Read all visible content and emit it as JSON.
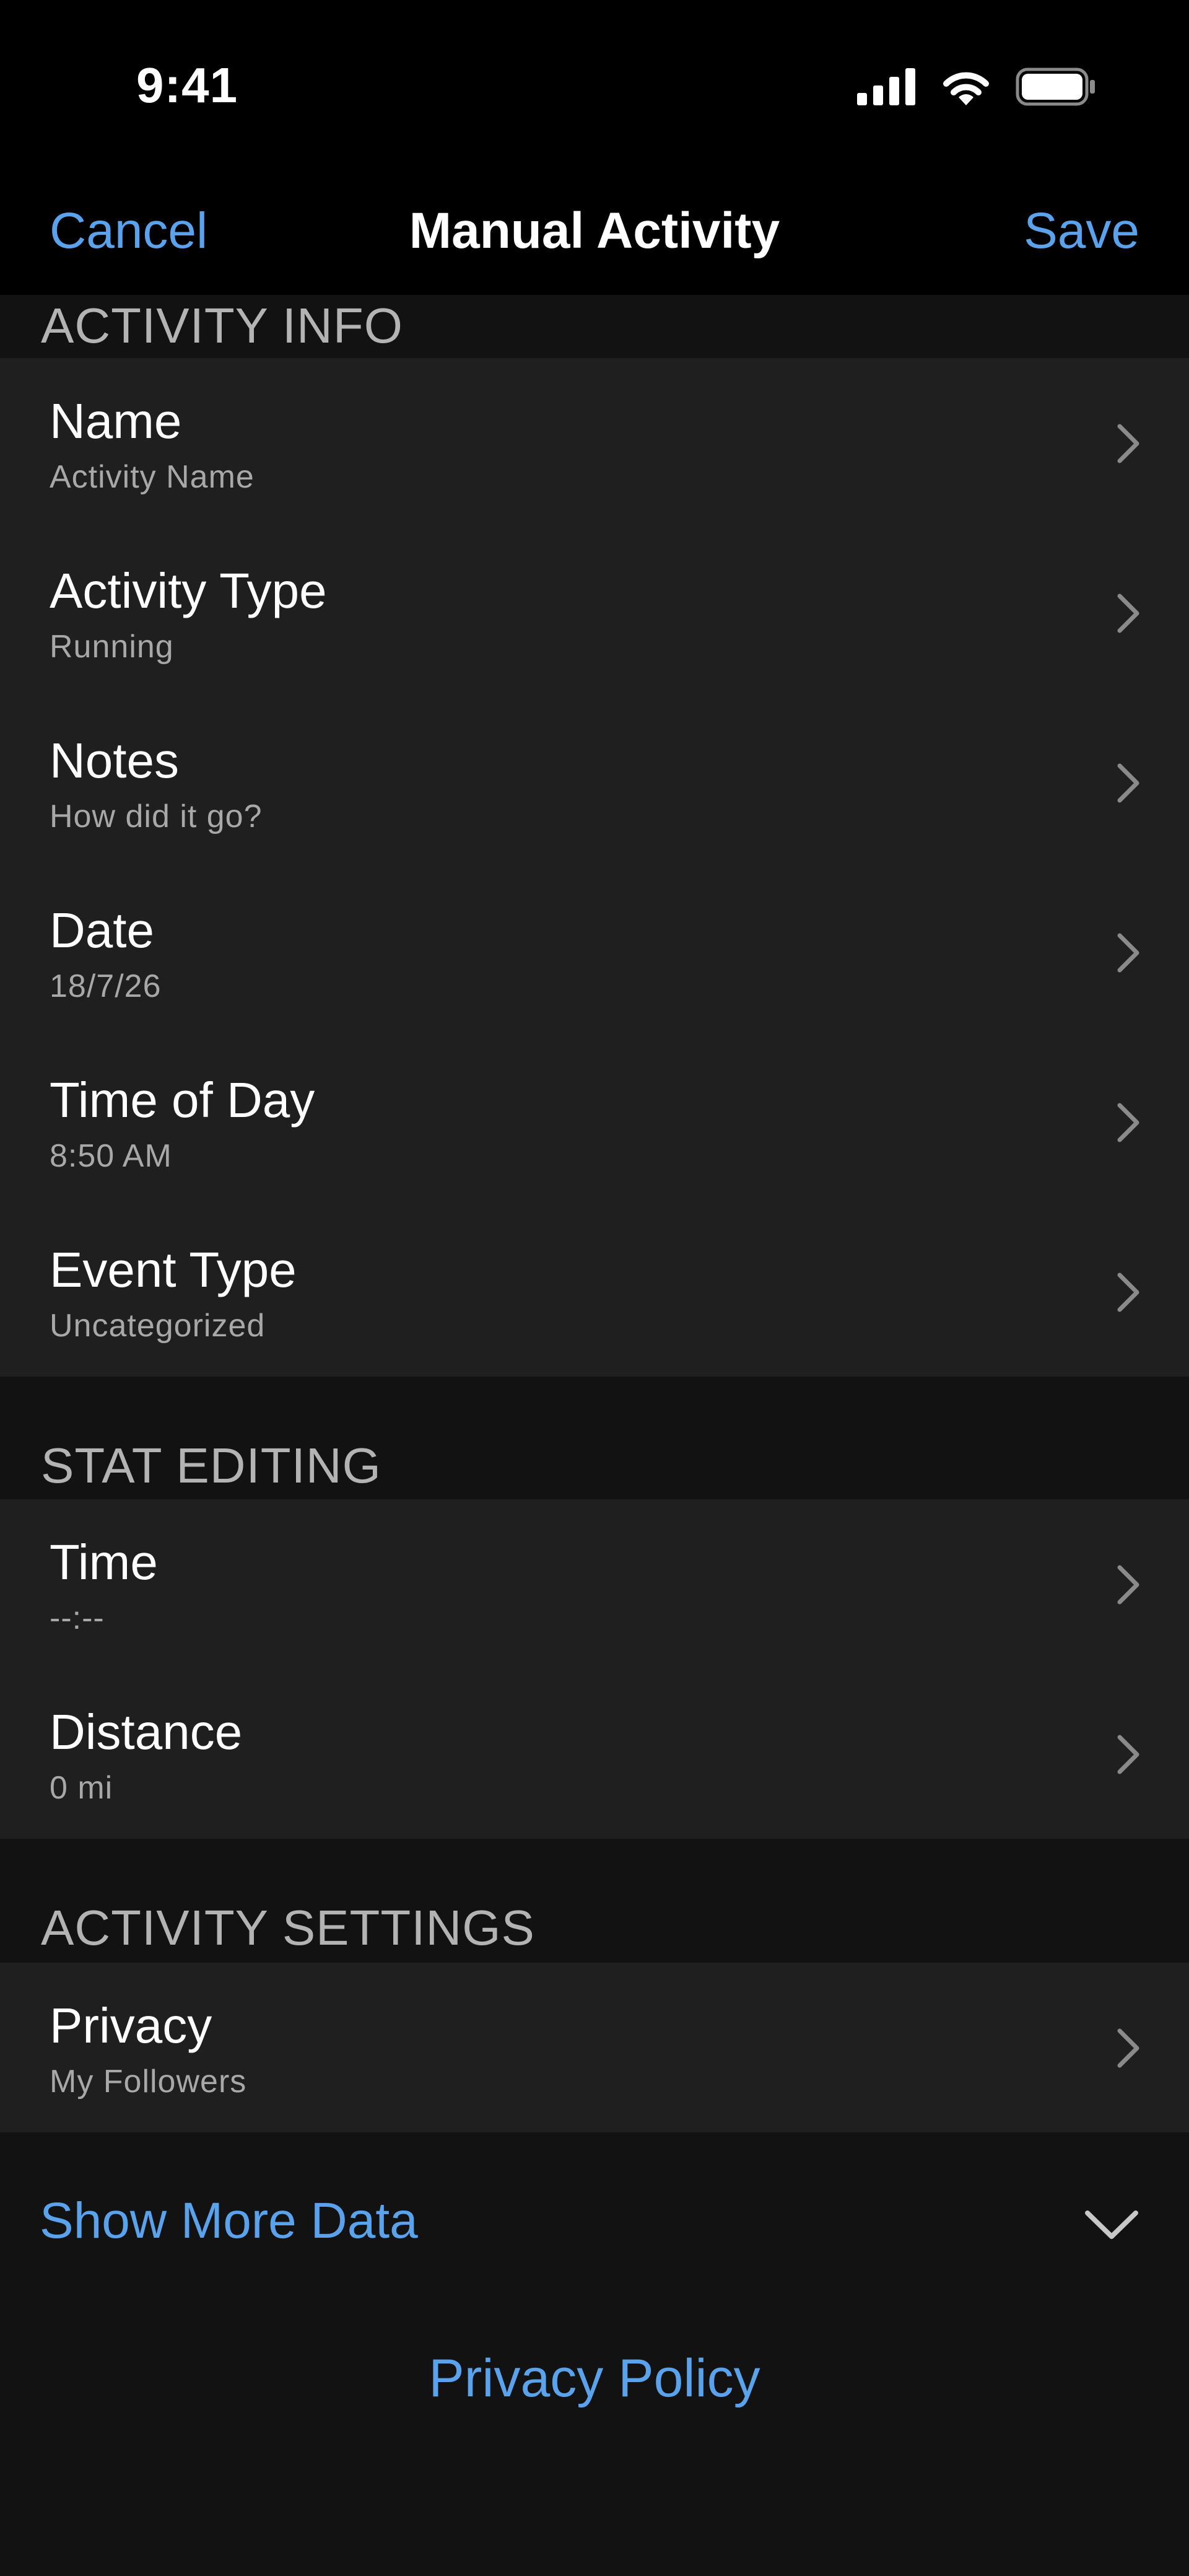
{
  "status_bar": {
    "time": "9:41"
  },
  "nav": {
    "cancel_label": "Cancel",
    "title": "Manual Activity",
    "save_label": "Save"
  },
  "sections": {
    "activity_info": {
      "header": "ACTIVITY INFO",
      "rows": [
        {
          "title": "Name",
          "value": "Activity Name"
        },
        {
          "title": "Activity Type",
          "value": "Running"
        },
        {
          "title": "Notes",
          "value": "How did it go?"
        },
        {
          "title": "Date",
          "value": "18/7/26"
        },
        {
          "title": "Time of Day",
          "value": "8:50 AM"
        },
        {
          "title": "Event Type",
          "value": "Uncategorized"
        }
      ]
    },
    "stat_editing": {
      "header": "STAT EDITING",
      "rows": [
        {
          "title": "Time",
          "value": "--:--"
        },
        {
          "title": "Distance",
          "value": "0 mi"
        }
      ]
    },
    "activity_settings": {
      "header": "ACTIVITY SETTINGS",
      "rows": [
        {
          "title": "Privacy",
          "value": "My Followers"
        }
      ]
    }
  },
  "show_more_label": "Show More Data",
  "privacy_policy_label": "Privacy Policy",
  "icons": {
    "row_chevron": "chevron-right-icon",
    "show_more": "chevron-down-icon",
    "signal": "cellular-signal-icon",
    "wifi": "wifi-icon",
    "battery": "battery-icon"
  },
  "colors": {
    "accent": "#5aa2ec",
    "background": "#121212",
    "bar_background": "#000000",
    "cell_background": "#1f1f1f",
    "secondary_text": "#a8a8a8",
    "section_header_text": "#b3b3b3"
  }
}
